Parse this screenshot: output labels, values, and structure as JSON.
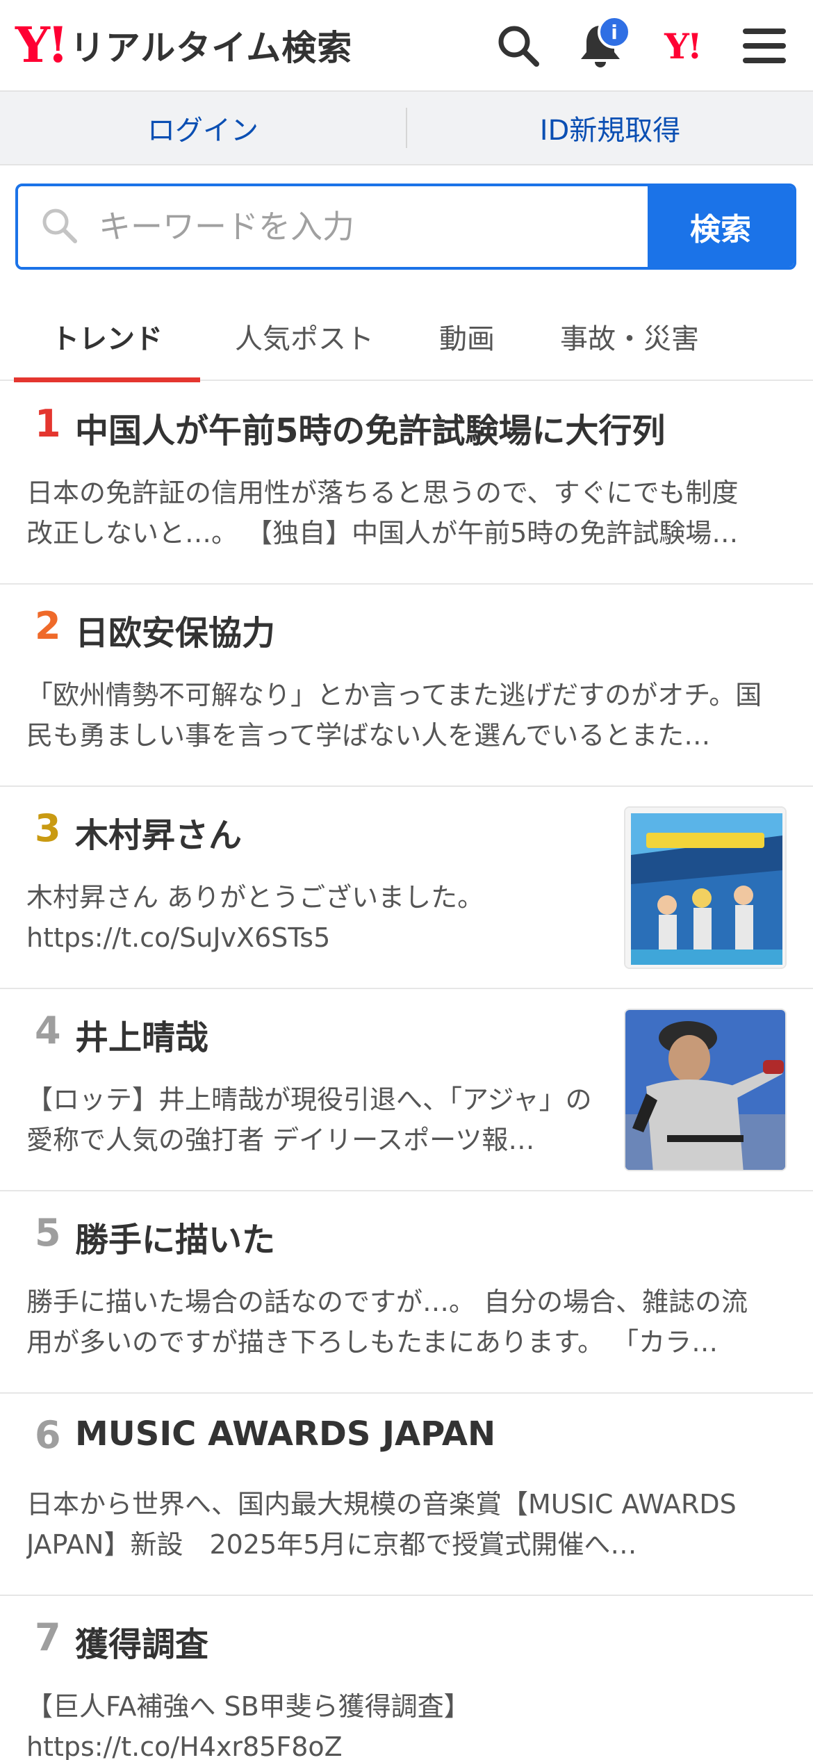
{
  "header": {
    "logo_mark": "Y!",
    "logo_text": "リアルタイム検索",
    "notification_badge": "i",
    "yahoo_mark": "Y!"
  },
  "login": {
    "login_label": "ログイン",
    "register_label": "ID新規取得"
  },
  "search": {
    "placeholder": "キーワードを入力",
    "button_label": "検索"
  },
  "tabs": [
    {
      "label": "トレンド",
      "active": true
    },
    {
      "label": "人気ポスト",
      "active": false
    },
    {
      "label": "動画",
      "active": false
    },
    {
      "label": "事故・災害",
      "active": false
    }
  ],
  "colors": {
    "rank1": "#e4362f",
    "rank2": "#ef6a2a",
    "rank3": "#c99a12",
    "rank_other": "#9e9e9e",
    "accent": "#1b73e8"
  },
  "trends": [
    {
      "rank": "1",
      "title": "中国人が午前5時の免許試験場に大行列",
      "desc": "日本の免許証の信用性が落ちると思うので、すぐにでも制度改正しないと…。 【独自】中国人が午前5時の免許試験場…"
    },
    {
      "rank": "2",
      "title": "日欧安保協力",
      "desc": "「欧州情勢不可解なり」とか言ってまた逃げだすのがオチ。国民も勇ましい事を言って学ばない人を選んでいるとまた…"
    },
    {
      "rank": "3",
      "title": "木村昇さん",
      "desc": "木村昇さん ありがとうございました。 https://t.co/SuJvX6STs5"
    },
    {
      "rank": "4",
      "title": "井上晴哉",
      "desc": "【ロッテ】井上晴哉が現役引退へ、「アジャ」の愛称で人気の強打者 デイリースポーツ報…"
    },
    {
      "rank": "5",
      "title": "勝手に描いた",
      "desc": "勝手に描いた場合の話なのですが…。 自分の場合、雑誌の流用が多いのですが描き下ろしもたまにあります。 「カラ…"
    },
    {
      "rank": "6",
      "title": "MUSIC AWARDS JAPAN",
      "desc": "日本から世界へ、国内最大規模の音楽賞【MUSIC AWARDS JAPAN】新設　2025年5月に京都で授賞式開催へ…"
    },
    {
      "rank": "7",
      "title": "獲得調査",
      "desc": "【巨人FA補強へ SB甲斐ら獲得調査】 https://t.co/H4xr85F8oZ"
    }
  ]
}
